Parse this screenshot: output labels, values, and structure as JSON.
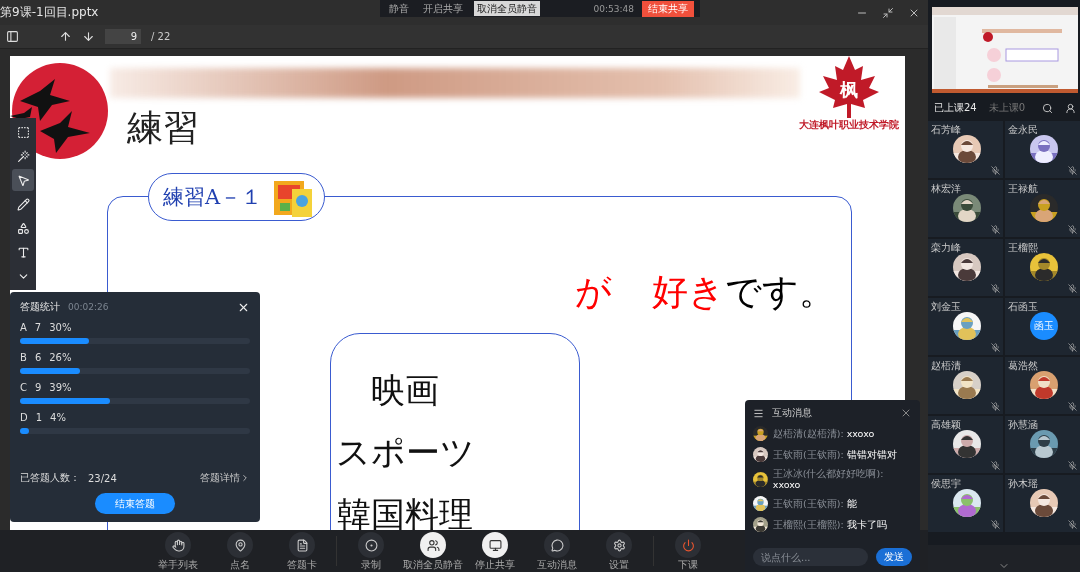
{
  "window": {
    "title": "第9课-1回目.pptx"
  },
  "meeting_bar": {
    "items": [
      {
        "label": "静音",
        "selected": false
      },
      {
        "label": "开启共享",
        "selected": false
      },
      {
        "label": "取消全员静音",
        "selected": true
      }
    ],
    "timer": "00:53:48",
    "end_button": "结束共享"
  },
  "toolbar": {
    "page": "9",
    "total": "/ 22"
  },
  "slide": {
    "title": "練習",
    "logo_mark": "枫",
    "logo_text": "大连枫叶职业技术学院",
    "exercise_label": "練習A－１",
    "sentence": [
      {
        "text": "が",
        "color": "#ff0000"
      },
      {
        "text": "好き",
        "color": "#ff0000"
      },
      {
        "text": "です。",
        "color": "#000000"
      }
    ],
    "choices": [
      "映画",
      "スポーツ",
      "韓国料理"
    ]
  },
  "slide_tools": [
    {
      "kind": "area",
      "selected": false
    },
    {
      "kind": "laser",
      "selected": false
    },
    {
      "kind": "pointer",
      "selected": true
    },
    {
      "kind": "pen",
      "selected": false
    },
    {
      "kind": "shapes",
      "selected": false
    },
    {
      "kind": "text",
      "selected": false
    },
    {
      "kind": "more",
      "selected": false
    }
  ],
  "answer_stats": {
    "title": "答题统计",
    "timer": "00:02:26",
    "options": [
      {
        "letter": "A",
        "count": "7",
        "percent": "30%",
        "level": 0.3
      },
      {
        "letter": "B",
        "count": "6",
        "percent": "26%",
        "level": 0.26
      },
      {
        "letter": "C",
        "count": "9",
        "percent": "39%",
        "level": 0.39
      },
      {
        "letter": "D",
        "count": "1",
        "percent": "4%",
        "level": 0.04
      }
    ],
    "answered_label": "已答题人数：",
    "answered": "23/24",
    "details_link": "答题详情",
    "end_button": "结束答题"
  },
  "chat": {
    "title": "互动消息",
    "messages": [
      {
        "sender": "赵梧清(赵梧清):",
        "text": "xxoxo"
      },
      {
        "sender": "王钦雨(王钦雨):",
        "text": "错错对错对"
      },
      {
        "sender": "王冰冰(什么都好好吃啊):",
        "text": "xxoxo"
      },
      {
        "sender": "王钦雨(王钦雨):",
        "text": "能"
      },
      {
        "sender": "王榴熙(王榴熙):",
        "text": "我卡了吗"
      }
    ],
    "placeholder": "说点什么...",
    "send_button": "发送"
  },
  "bottom_bar": {
    "buttons": [
      {
        "kind": "hand",
        "label": "举手列表",
        "active": false
      },
      {
        "kind": "rollcall",
        "label": "点名",
        "active": false
      },
      {
        "kind": "card",
        "label": "答题卡",
        "active": false
      },
      {
        "kind": "record",
        "label": "录制",
        "active": false
      },
      {
        "kind": "mute",
        "label": "取消全员静音",
        "active": true
      },
      {
        "kind": "share",
        "label": "停止共享",
        "active": true
      },
      {
        "kind": "chat",
        "label": "互动消息",
        "active": false
      },
      {
        "kind": "settings",
        "label": "设置",
        "active": false
      },
      {
        "kind": "power",
        "label": "下课",
        "active": false
      }
    ]
  },
  "sidebar": {
    "tabs": [
      {
        "label": "已上课24",
        "selected": true
      },
      {
        "label": "未上课0",
        "selected": false
      }
    ],
    "students": [
      {
        "name": "石芳峰"
      },
      {
        "name": "金永民"
      },
      {
        "name": "林宏洋"
      },
      {
        "name": "王禄航"
      },
      {
        "name": "栾力峰"
      },
      {
        "name": "王榴熙"
      },
      {
        "name": "刘金玉"
      },
      {
        "name": "石函玉",
        "avatar": {
          "kind": "initials",
          "text": "函玉"
        }
      },
      {
        "name": "赵梧清"
      },
      {
        "name": "葛浩然"
      },
      {
        "name": "高雄颖"
      },
      {
        "name": "孙慧涵"
      },
      {
        "name": "侯思宇"
      },
      {
        "name": "孙木瑶"
      }
    ]
  }
}
